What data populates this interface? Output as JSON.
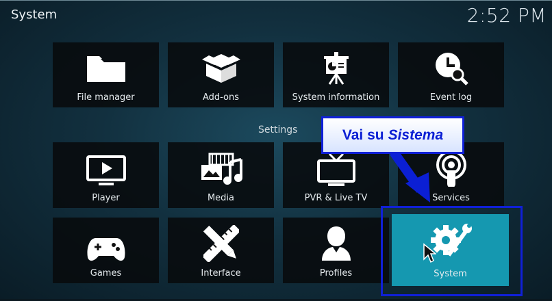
{
  "header": {
    "title": "System",
    "clock": "2:52 PM"
  },
  "top_row": [
    {
      "label": "File manager",
      "icon": "folder-icon"
    },
    {
      "label": "Add-ons",
      "icon": "open-box-icon"
    },
    {
      "label": "System information",
      "icon": "presentation-chart-icon"
    },
    {
      "label": "Event log",
      "icon": "clock-search-icon"
    }
  ],
  "section": {
    "label": "Settings"
  },
  "settings_rows": [
    {
      "label": "Player",
      "icon": "tv-play-icon"
    },
    {
      "label": "Media",
      "icon": "media-library-icon"
    },
    {
      "label": "PVR & Live TV",
      "icon": "tv-antenna-icon"
    },
    {
      "label": "Services",
      "icon": "broadcast-icon"
    },
    {
      "label": "Games",
      "icon": "gamepad-icon"
    },
    {
      "label": "Interface",
      "icon": "pencil-ruler-icon"
    },
    {
      "label": "Profiles",
      "icon": "user-icon"
    },
    {
      "label": "System",
      "icon": "gear-wrench-icon",
      "focused": true
    }
  ],
  "annotation": {
    "text_plain": "Vai su",
    "text_italic": "Sistema"
  },
  "colors": {
    "focus_tile": "#1598b0",
    "annotation": "#1020d8",
    "tile_bg": "#080a0c"
  }
}
